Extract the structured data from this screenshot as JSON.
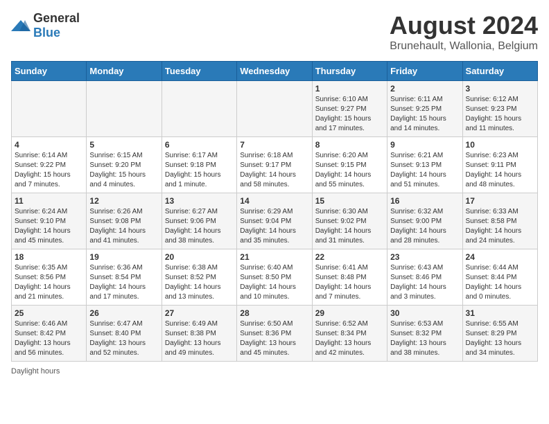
{
  "header": {
    "logo_general": "General",
    "logo_blue": "Blue",
    "month_year": "August 2024",
    "location": "Brunehault, Wallonia, Belgium"
  },
  "days_of_week": [
    "Sunday",
    "Monday",
    "Tuesday",
    "Wednesday",
    "Thursday",
    "Friday",
    "Saturday"
  ],
  "weeks": [
    [
      {
        "day": "",
        "info": ""
      },
      {
        "day": "",
        "info": ""
      },
      {
        "day": "",
        "info": ""
      },
      {
        "day": "",
        "info": ""
      },
      {
        "day": "1",
        "info": "Sunrise: 6:10 AM\nSunset: 9:27 PM\nDaylight: 15 hours and 17 minutes."
      },
      {
        "day": "2",
        "info": "Sunrise: 6:11 AM\nSunset: 9:25 PM\nDaylight: 15 hours and 14 minutes."
      },
      {
        "day": "3",
        "info": "Sunrise: 6:12 AM\nSunset: 9:23 PM\nDaylight: 15 hours and 11 minutes."
      }
    ],
    [
      {
        "day": "4",
        "info": "Sunrise: 6:14 AM\nSunset: 9:22 PM\nDaylight: 15 hours and 7 minutes."
      },
      {
        "day": "5",
        "info": "Sunrise: 6:15 AM\nSunset: 9:20 PM\nDaylight: 15 hours and 4 minutes."
      },
      {
        "day": "6",
        "info": "Sunrise: 6:17 AM\nSunset: 9:18 PM\nDaylight: 15 hours and 1 minute."
      },
      {
        "day": "7",
        "info": "Sunrise: 6:18 AM\nSunset: 9:17 PM\nDaylight: 14 hours and 58 minutes."
      },
      {
        "day": "8",
        "info": "Sunrise: 6:20 AM\nSunset: 9:15 PM\nDaylight: 14 hours and 55 minutes."
      },
      {
        "day": "9",
        "info": "Sunrise: 6:21 AM\nSunset: 9:13 PM\nDaylight: 14 hours and 51 minutes."
      },
      {
        "day": "10",
        "info": "Sunrise: 6:23 AM\nSunset: 9:11 PM\nDaylight: 14 hours and 48 minutes."
      }
    ],
    [
      {
        "day": "11",
        "info": "Sunrise: 6:24 AM\nSunset: 9:10 PM\nDaylight: 14 hours and 45 minutes."
      },
      {
        "day": "12",
        "info": "Sunrise: 6:26 AM\nSunset: 9:08 PM\nDaylight: 14 hours and 41 minutes."
      },
      {
        "day": "13",
        "info": "Sunrise: 6:27 AM\nSunset: 9:06 PM\nDaylight: 14 hours and 38 minutes."
      },
      {
        "day": "14",
        "info": "Sunrise: 6:29 AM\nSunset: 9:04 PM\nDaylight: 14 hours and 35 minutes."
      },
      {
        "day": "15",
        "info": "Sunrise: 6:30 AM\nSunset: 9:02 PM\nDaylight: 14 hours and 31 minutes."
      },
      {
        "day": "16",
        "info": "Sunrise: 6:32 AM\nSunset: 9:00 PM\nDaylight: 14 hours and 28 minutes."
      },
      {
        "day": "17",
        "info": "Sunrise: 6:33 AM\nSunset: 8:58 PM\nDaylight: 14 hours and 24 minutes."
      }
    ],
    [
      {
        "day": "18",
        "info": "Sunrise: 6:35 AM\nSunset: 8:56 PM\nDaylight: 14 hours and 21 minutes."
      },
      {
        "day": "19",
        "info": "Sunrise: 6:36 AM\nSunset: 8:54 PM\nDaylight: 14 hours and 17 minutes."
      },
      {
        "day": "20",
        "info": "Sunrise: 6:38 AM\nSunset: 8:52 PM\nDaylight: 14 hours and 13 minutes."
      },
      {
        "day": "21",
        "info": "Sunrise: 6:40 AM\nSunset: 8:50 PM\nDaylight: 14 hours and 10 minutes."
      },
      {
        "day": "22",
        "info": "Sunrise: 6:41 AM\nSunset: 8:48 PM\nDaylight: 14 hours and 7 minutes."
      },
      {
        "day": "23",
        "info": "Sunrise: 6:43 AM\nSunset: 8:46 PM\nDaylight: 14 hours and 3 minutes."
      },
      {
        "day": "24",
        "info": "Sunrise: 6:44 AM\nSunset: 8:44 PM\nDaylight: 14 hours and 0 minutes."
      }
    ],
    [
      {
        "day": "25",
        "info": "Sunrise: 6:46 AM\nSunset: 8:42 PM\nDaylight: 13 hours and 56 minutes."
      },
      {
        "day": "26",
        "info": "Sunrise: 6:47 AM\nSunset: 8:40 PM\nDaylight: 13 hours and 52 minutes."
      },
      {
        "day": "27",
        "info": "Sunrise: 6:49 AM\nSunset: 8:38 PM\nDaylight: 13 hours and 49 minutes."
      },
      {
        "day": "28",
        "info": "Sunrise: 6:50 AM\nSunset: 8:36 PM\nDaylight: 13 hours and 45 minutes."
      },
      {
        "day": "29",
        "info": "Sunrise: 6:52 AM\nSunset: 8:34 PM\nDaylight: 13 hours and 42 minutes."
      },
      {
        "day": "30",
        "info": "Sunrise: 6:53 AM\nSunset: 8:32 PM\nDaylight: 13 hours and 38 minutes."
      },
      {
        "day": "31",
        "info": "Sunrise: 6:55 AM\nSunset: 8:29 PM\nDaylight: 13 hours and 34 minutes."
      }
    ]
  ],
  "footer": {
    "daylight_label": "Daylight hours"
  }
}
